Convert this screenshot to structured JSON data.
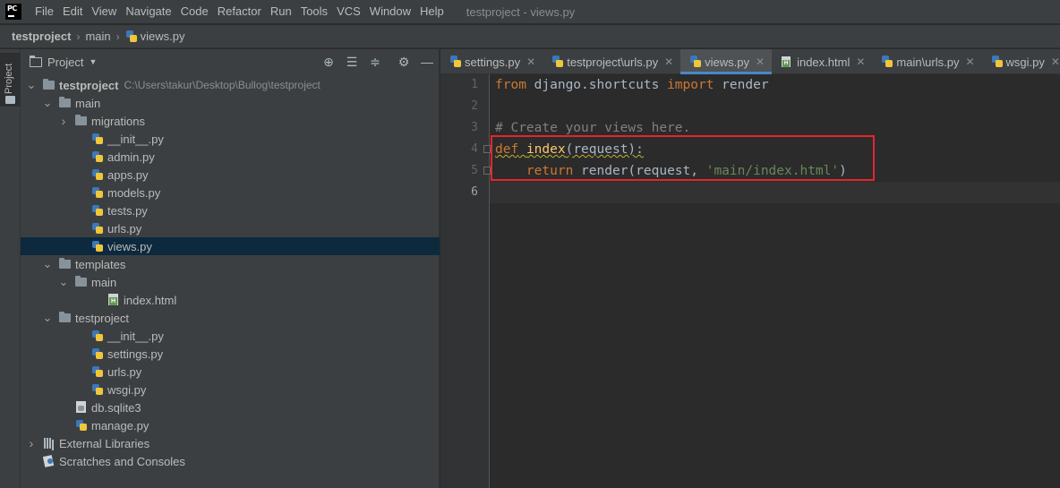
{
  "app": {
    "logo_text": "PC",
    "window_title": "testproject - views.py"
  },
  "menu": [
    "File",
    "Edit",
    "View",
    "Navigate",
    "Code",
    "Refactor",
    "Run",
    "Tools",
    "VCS",
    "Window",
    "Help"
  ],
  "breadcrumb": [
    "testproject",
    "main",
    "views.py"
  ],
  "tool_stripe": {
    "project_label": "Project"
  },
  "project_panel": {
    "title": "Project",
    "tree": [
      {
        "label": "testproject",
        "path": "C:\\Users\\takur\\Desktop\\Bullog\\testproject",
        "icon": "folder",
        "depth": 0,
        "expanded": true,
        "bold": true
      },
      {
        "label": "main",
        "icon": "folder",
        "depth": 1,
        "expanded": true
      },
      {
        "label": "migrations",
        "icon": "folder",
        "depth": 2,
        "expanded": false
      },
      {
        "label": "__init__.py",
        "icon": "python",
        "depth": 3
      },
      {
        "label": "admin.py",
        "icon": "python",
        "depth": 3
      },
      {
        "label": "apps.py",
        "icon": "python",
        "depth": 3
      },
      {
        "label": "models.py",
        "icon": "python",
        "depth": 3
      },
      {
        "label": "tests.py",
        "icon": "python",
        "depth": 3
      },
      {
        "label": "urls.py",
        "icon": "python",
        "depth": 3
      },
      {
        "label": "views.py",
        "icon": "python",
        "depth": 3,
        "selected": true
      },
      {
        "label": "templates",
        "icon": "folder",
        "depth": 1,
        "expanded": true
      },
      {
        "label": "main",
        "icon": "folder",
        "depth": 2,
        "expanded": true
      },
      {
        "label": "index.html",
        "icon": "html",
        "depth": 4
      },
      {
        "label": "testproject",
        "icon": "folder",
        "depth": 1,
        "expanded": true
      },
      {
        "label": "__init__.py",
        "icon": "python",
        "depth": 3
      },
      {
        "label": "settings.py",
        "icon": "python",
        "depth": 3
      },
      {
        "label": "urls.py",
        "icon": "python",
        "depth": 3
      },
      {
        "label": "wsgi.py",
        "icon": "python",
        "depth": 3
      },
      {
        "label": "db.sqlite3",
        "icon": "database",
        "depth": 2
      },
      {
        "label": "manage.py",
        "icon": "python",
        "depth": 2
      },
      {
        "label": "External Libraries",
        "icon": "library",
        "depth": 0,
        "expanded": false
      },
      {
        "label": "Scratches and Consoles",
        "icon": "scratch",
        "depth": 0
      }
    ]
  },
  "tabs": [
    {
      "label": "settings.py",
      "icon": "python"
    },
    {
      "label": "testproject\\urls.py",
      "icon": "python"
    },
    {
      "label": "views.py",
      "icon": "python",
      "active": true
    },
    {
      "label": "index.html",
      "icon": "html"
    },
    {
      "label": "main\\urls.py",
      "icon": "python"
    },
    {
      "label": "wsgi.py",
      "icon": "python"
    }
  ],
  "editor": {
    "line_numbers": [
      "1",
      "2",
      "3",
      "4",
      "5",
      "6"
    ],
    "code": {
      "l1_from": "from",
      "l1_mod": " django.shortcuts ",
      "l1_import": "import",
      "l1_name": " render",
      "l3_comment": "# Create your views here.",
      "l4_def": "def",
      "l4_name": "index",
      "l4_rest": "(request):",
      "l5_indent": "    ",
      "l5_return": "return",
      "l5_call": " render(request, ",
      "l5_str": "'main/index.html'",
      "l5_end": ")"
    }
  },
  "colors": {
    "highlight_box": "#e3262e",
    "selection": "#0d293e",
    "active_tab_underline": "#4a88c7"
  }
}
